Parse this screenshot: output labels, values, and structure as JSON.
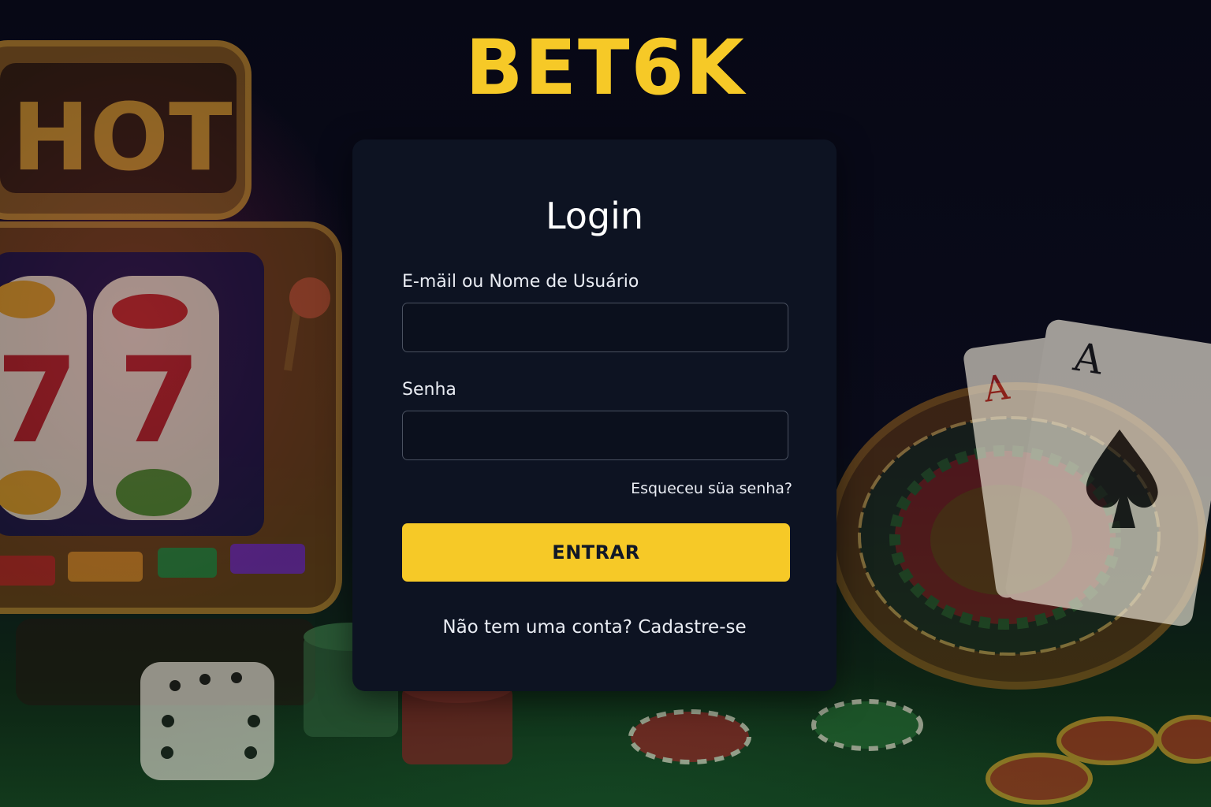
{
  "brand": {
    "logo_text": "BET6K",
    "accent_color": "#f6c927"
  },
  "background": {
    "slot_machine_sign": "HOT",
    "slot_reel_symbols": [
      "7",
      "7"
    ],
    "card_ranks": [
      "A",
      "A"
    ],
    "icons": [
      "slot-machine-icon",
      "roulette-wheel-icon",
      "playing-cards-icon",
      "dice-icon",
      "poker-chips-icon"
    ]
  },
  "login": {
    "title": "Login",
    "username_label": "E-mäil ou Nome de Usuário",
    "username_value": "",
    "password_label": "Senha",
    "password_value": "",
    "forgot_link": "Esqueceu süa senha?",
    "submit_label": "ENTRAR",
    "signup_prompt": "Não tem uma conta?",
    "signup_link": "Cadastre-se"
  }
}
